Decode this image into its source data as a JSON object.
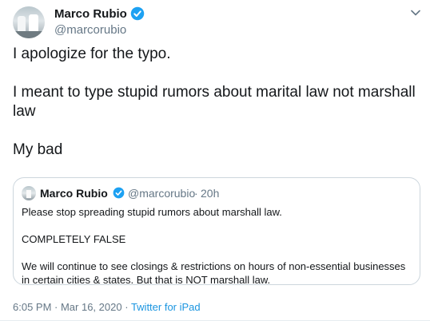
{
  "author": {
    "name": "Marco Rubio",
    "handle": "@marcorubio",
    "verified_icon": "verified-badge-icon",
    "menu_icon": "chevron-down-icon"
  },
  "tweet": {
    "paragraphs": [
      "I apologize for the typo.",
      "I meant to type stupid rumors about marital law not marshall law",
      "My bad"
    ]
  },
  "quoted_tweet": {
    "name": "Marco Rubio",
    "handle": "@marcorubio",
    "separator": "·",
    "time": "20h",
    "paragraphs": [
      "Please stop spreading stupid rumors about marshall law.",
      "COMPLETELY FALSE",
      "We will continue to see closings & restrictions on hours of non-essential businesses in certain cities & states. But that is NOT marshall law."
    ]
  },
  "footer": {
    "timestamp": "6:05 PM · Mar 16, 2020",
    "separator": "·",
    "source": "Twitter for iPad"
  },
  "colors": {
    "text": "#14171a",
    "secondary": "#657786",
    "link": "#1b95e0",
    "verified": "#1da1f2",
    "border": "#ccd6dd"
  }
}
